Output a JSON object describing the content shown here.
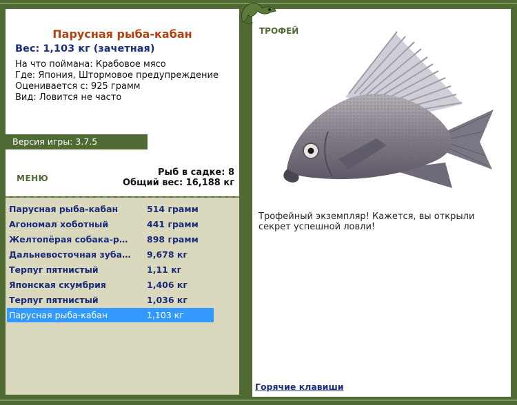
{
  "fish": {
    "title": "Парусная рыба-кабан",
    "weight": "Вес: 1,103 кг (зачетная)",
    "bait": "На что поймана: Крабовое мясо",
    "location": "Где: Япония, Штормовое предупреждение",
    "valued": "Оценивается с: 925 грамм",
    "rarity": "Вид: Ловится не часто"
  },
  "version": "Версия игры: 3.7.5",
  "menu": {
    "title": "МЕНЮ"
  },
  "keepnet": {
    "count": "Рыб в садке: 8",
    "total": "Общий вес: 16,188 кг"
  },
  "catch_list": [
    {
      "name": "Парусная рыба-кабан",
      "weight": "514 грамм"
    },
    {
      "name": "Агономал хоботный",
      "weight": "441 грамм"
    },
    {
      "name": "Желтопёрая собака-ры…",
      "weight": "898 грамм"
    },
    {
      "name": "Дальневосточная зуба…",
      "weight": "9,678 кг"
    },
    {
      "name": "Терпуг пятнистый",
      "weight": "1,11 кг"
    },
    {
      "name": "Японская скумбрия",
      "weight": "1,406 кг"
    },
    {
      "name": "Терпуг пятнистый",
      "weight": "1,036 кг"
    },
    {
      "name": "Парусная рыба-кабан",
      "weight": "1,103 кг"
    }
  ],
  "selected_index": 7,
  "trophy": {
    "label": "ТРОФЕЙ",
    "text": "Трофейный экземпляр! Кажется, вы открыли секрет успешной ловли!"
  },
  "hotkeys": "Горячие клавиши",
  "colors": {
    "frame": "#4f6b33",
    "title": "#b4400f",
    "accent": "#1c2f7e",
    "selection": "#3399ff",
    "list_bg": "#dad9bd"
  }
}
